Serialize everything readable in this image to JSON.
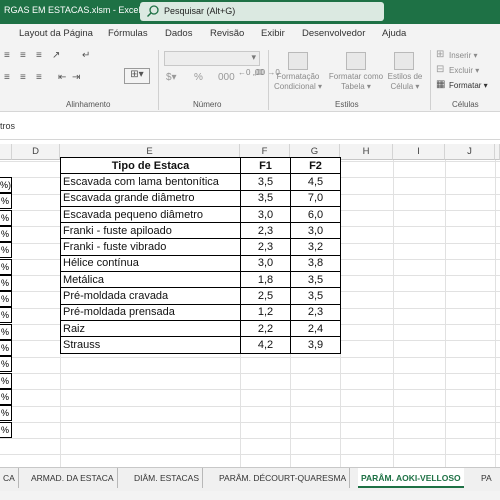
{
  "window": {
    "title": "RGAS EM ESTACAS.xlsm  -  Excel"
  },
  "search": {
    "placeholder": "Pesquisar (Alt+G)"
  },
  "ribbon": {
    "tabs": [
      "Layout da Página",
      "Fórmulas",
      "Dados",
      "Revisão",
      "Exibir",
      "Desenvolvedor",
      "Ajuda"
    ],
    "groups": {
      "alignment": "Alinhamento",
      "number": "Número",
      "styles": "Estilos",
      "cells": "Células"
    },
    "styles_buttons": {
      "conditional_formatting": [
        "Formatação",
        "Condicional ▾"
      ],
      "format_as_table": [
        "Formatar como",
        "Tabela ▾"
      ],
      "cell_styles": [
        "Estilos de",
        "Célula ▾"
      ]
    },
    "cells_buttons": {
      "insert": "Inserir ▾",
      "delete": "Excluir ▾",
      "format": "Formatar ▾"
    },
    "number_decimals": {
      "inc": "←0 ,00",
      "dec": ",00 →0"
    }
  },
  "formula_bar": {
    "content": "tros"
  },
  "grid": {
    "column_headers": [
      "D",
      "E",
      "F",
      "G",
      "H",
      "I",
      "J"
    ],
    "column_a_partial": [
      "%)",
      "%",
      "%",
      "%",
      "%",
      "%",
      "%",
      "%",
      "%",
      "%",
      "%",
      "%",
      "%",
      "%",
      "%",
      "%"
    ],
    "table": {
      "headers": [
        "Tipo de Estaca",
        "F1",
        "F2"
      ],
      "rows": [
        [
          "Escavada com lama bentonítica",
          "3,5",
          "4,5"
        ],
        [
          "Escavada grande diâmetro",
          "3,5",
          "7,0"
        ],
        [
          "Escavada pequeno diâmetro",
          "3,0",
          "6,0"
        ],
        [
          "Franki - fuste apiloado",
          "2,3",
          "3,0"
        ],
        [
          "Franki - fuste vibrado",
          "2,3",
          "3,2"
        ],
        [
          "Hélice contínua",
          "3,0",
          "3,8"
        ],
        [
          "Metálica",
          "1,8",
          "3,5"
        ],
        [
          "Pré-moldada cravada",
          "2,5",
          "3,5"
        ],
        [
          "Pré-moldada prensada",
          "1,2",
          "2,3"
        ],
        [
          "Raiz",
          "2,2",
          "2,4"
        ],
        [
          "Strauss",
          "4,2",
          "3,9"
        ]
      ]
    }
  },
  "sheet_tabs": [
    "CA",
    "ARMAD. DA ESTACA",
    "DIÂM. ESTACAS",
    "PARÂM. DÉCOURT-QUARESMA",
    "PARÂM. AOKI-VELLOSO",
    "PA"
  ],
  "active_sheet_index": 4,
  "colors": {
    "excel_green": "#1e7145",
    "ribbon_bg": "#f3f3f3"
  }
}
